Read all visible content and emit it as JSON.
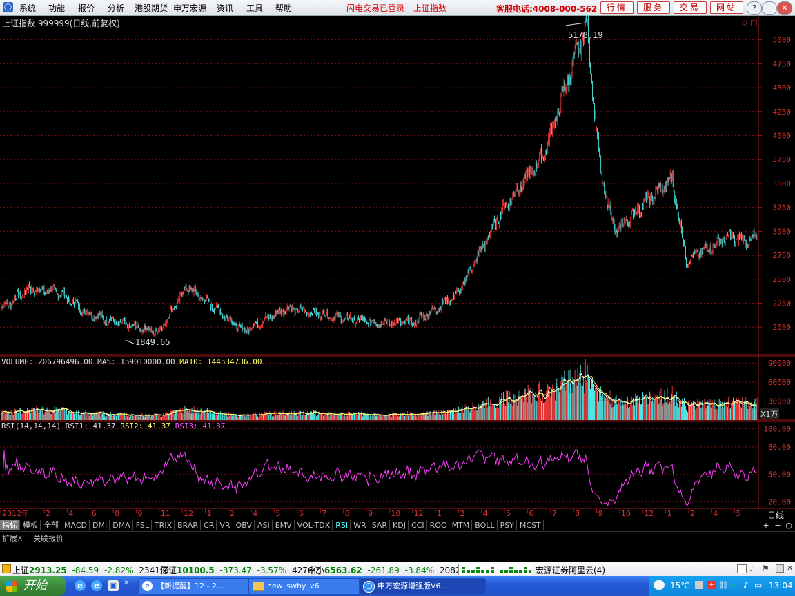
{
  "app": {
    "menu": [
      "系统",
      "功能",
      "报价",
      "分析",
      "港股期货",
      "申万宏源",
      "资讯",
      "工具",
      "帮助"
    ],
    "status_msgs": [
      "闪电交易已登录",
      "上证指数"
    ],
    "hotline": "客服电话:4008-000-562",
    "nav_buttons": [
      "行情",
      "服务",
      "交易",
      "网站"
    ],
    "window_buttons": [
      "?",
      "−",
      "▢",
      "✕"
    ]
  },
  "chart": {
    "title": "上证指数 999999(日线,前复权)",
    "high_label": "5178.19",
    "low_label": "1849.65",
    "price_ticks": [
      "5000",
      "4750",
      "4500",
      "4250",
      "4000",
      "3750",
      "3500",
      "3250",
      "3000",
      "2750",
      "2500",
      "2250",
      "2000"
    ],
    "volume_header": {
      "prefix": "VOLUME: 206796496.00",
      "ma5": "MA5: 159010000.00",
      "ma10": "MA10: 144534736.00"
    },
    "volume_ticks": [
      "90000",
      "60000",
      "30000"
    ],
    "volume_unit": "X1万",
    "rsi_header": {
      "prefix": "RSI(14,14,14)",
      "rsi1": "RSI1: 41.37",
      "rsi2": "RSI2: 41.37",
      "rsi3": "RSI3: 41.37"
    },
    "rsi_ticks": [
      "100.00",
      "80.00",
      "50.00",
      "20.00"
    ],
    "date_labels": [
      "2012年",
      "2",
      "4",
      "6",
      "8",
      "9",
      "11",
      "12",
      "1",
      "2",
      "4",
      "5",
      "6",
      "7",
      "8",
      "9",
      "10",
      "12",
      "1",
      "2",
      "4",
      "5",
      "6",
      "7",
      "8",
      "9",
      "10",
      "12",
      "1",
      "2",
      "4",
      "5"
    ],
    "period_label": "日线",
    "corner_buttons": [
      "+",
      "−",
      "○"
    ]
  },
  "chart_data": {
    "type": "candlestick",
    "title": "上证指数 999999(日线,前复权)",
    "ylim": [
      1800,
      5300
    ],
    "annotations": {
      "high": 5178.19,
      "low": 1849.65
    },
    "close_series": [
      [
        "2012-01",
        2200
      ],
      [
        "2012-03",
        2400
      ],
      [
        "2012-05",
        2370
      ],
      [
        "2012-07",
        2150
      ],
      [
        "2012-09",
        2050
      ],
      [
        "2012-12",
        1950
      ],
      [
        "2013-02",
        2420
      ],
      [
        "2013-04",
        2200
      ],
      [
        "2013-06",
        1960
      ],
      [
        "2013-09",
        2200
      ],
      [
        "2013-12",
        2120
      ],
      [
        "2014-03",
        2050
      ],
      [
        "2014-06",
        2050
      ],
      [
        "2014-09",
        2350
      ],
      [
        "2014-12",
        3200
      ],
      [
        "2015-03",
        3800
      ],
      [
        "2015-06",
        5178
      ],
      [
        "2015-07",
        3600
      ],
      [
        "2015-08",
        3000
      ],
      [
        "2015-12",
        3550
      ],
      [
        "2016-01",
        2700
      ],
      [
        "2016-04",
        2950
      ],
      [
        "2016-05",
        2900
      ]
    ],
    "volume": {
      "value": 206796496.0,
      "ma5": 159010000.0,
      "ma10": 144534736.0
    },
    "rsi": {
      "rsi1": 41.37,
      "rsi2": 41.37,
      "rsi3": 41.37
    }
  },
  "tabs": {
    "row1": [
      "指标",
      "模板",
      "全部",
      "MACD",
      "DMI",
      "DMA",
      "FSL",
      "TRIX",
      "BRAR",
      "CR",
      "VR",
      "OBV",
      "ASI",
      "EMV",
      "VOL-TDX",
      "RSI",
      "WR",
      "SAR",
      "KDJ",
      "CCI",
      "ROC",
      "MTM",
      "BOLL",
      "PSY",
      "MCST"
    ],
    "row2": [
      "扩展∧",
      "关联报价"
    ]
  },
  "statusbar": {
    "sh_name": "上证",
    "sh_value": "2913.25",
    "sh_change": "-84.59",
    "sh_pct": "-2.82%",
    "sh_amt": "2341亿",
    "sz_name": "深证",
    "sz_value": "10100.5",
    "sz_change": "-373.47",
    "sz_pct": "-3.57%",
    "sz_amt": "4276亿",
    "zx_name": "中小",
    "zx_value": "6563.62",
    "zx_change": "-261.89",
    "zx_pct": "-3.84%",
    "zx_amt": "2082亿",
    "server": "宏源证券阿里云(4)"
  },
  "taskbar": {
    "start": "开始",
    "items": [
      "【新提醒】12 - 2...",
      "new_swhy_v6",
      "申万宏源增强版V6..."
    ],
    "temp": "15℃",
    "clock": "13:04"
  }
}
